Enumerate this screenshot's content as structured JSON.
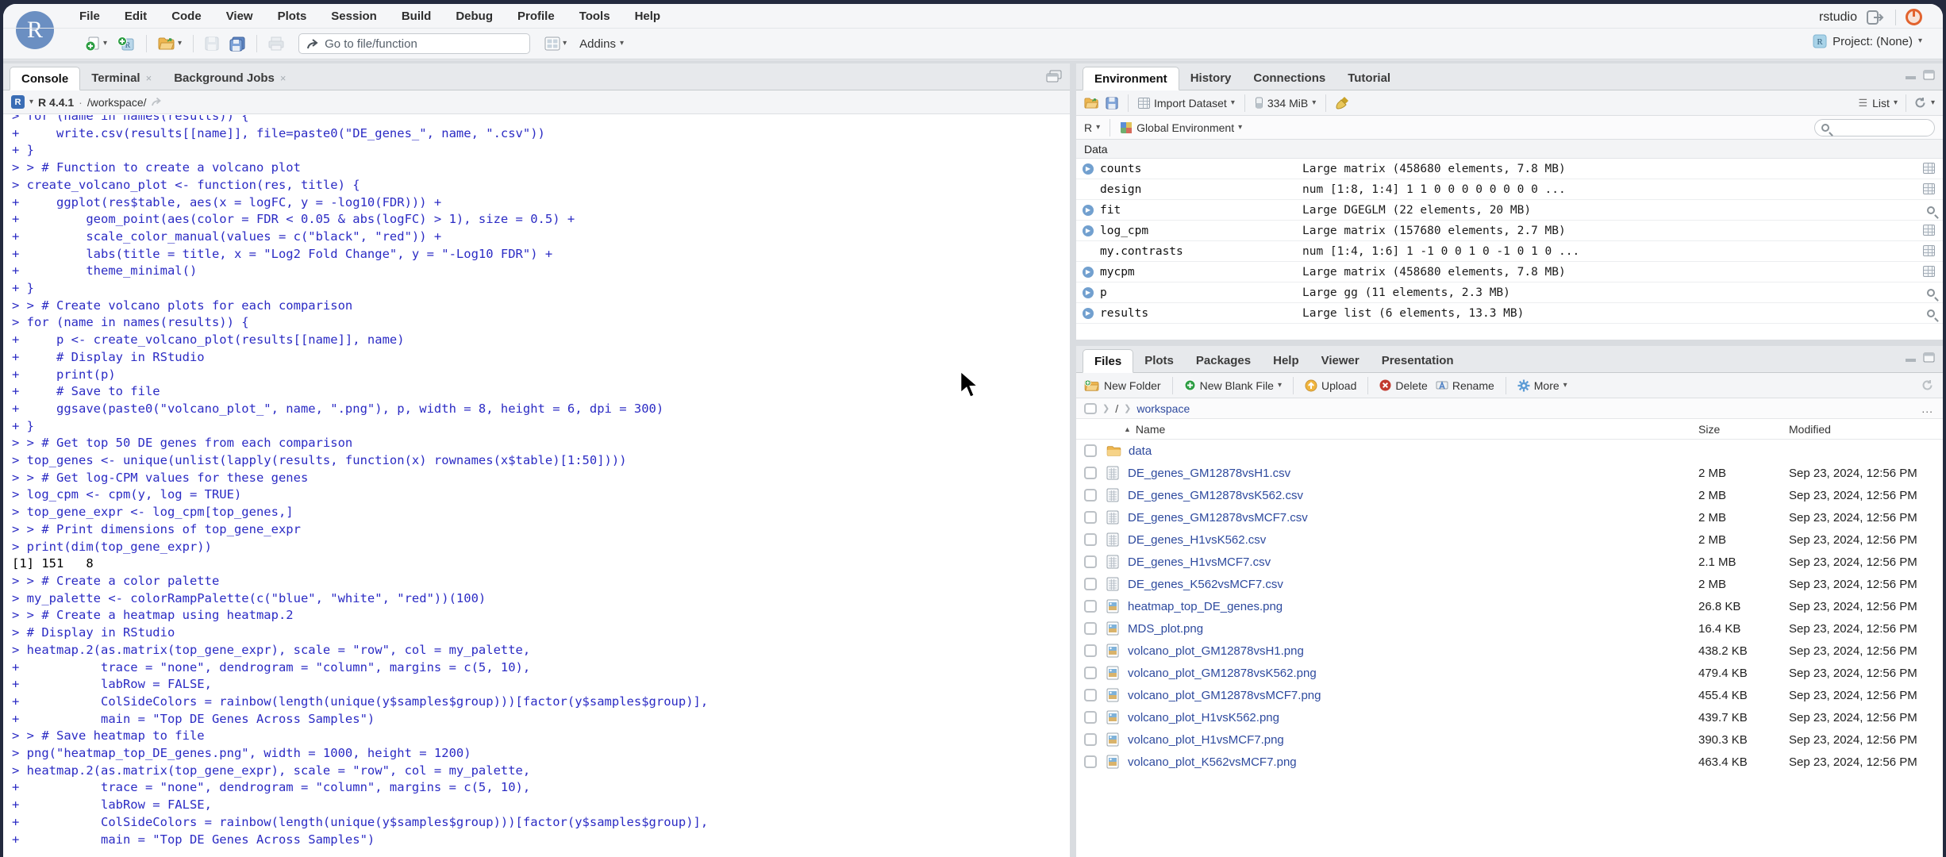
{
  "window": {
    "user_label": "rstudio",
    "project_label": "Project: (None)"
  },
  "menubar": {
    "items": [
      "File",
      "Edit",
      "Code",
      "View",
      "Plots",
      "Session",
      "Build",
      "Debug",
      "Profile",
      "Tools",
      "Help"
    ]
  },
  "toolbar": {
    "goto_placeholder": "Go to file/function",
    "addins_label": "Addins"
  },
  "console": {
    "tabs": [
      {
        "label": "Console",
        "active": true,
        "closable": false
      },
      {
        "label": "Terminal",
        "active": false,
        "closable": true
      },
      {
        "label": "Background Jobs",
        "active": false,
        "closable": true
      }
    ],
    "header": {
      "r_version": "R 4.4.1",
      "separator": "·",
      "path": "/workspace/"
    },
    "lines": [
      {
        "text": "> for (name in names(results)) {",
        "type": "input"
      },
      {
        "text": "+     write.csv(results[[name]], file=paste0(\"DE_genes_\", name, \".csv\"))",
        "type": "input"
      },
      {
        "text": "+ }",
        "type": "input"
      },
      {
        "text": "> > # Function to create a volcano plot",
        "type": "input"
      },
      {
        "text": "> create_volcano_plot <- function(res, title) {",
        "type": "input"
      },
      {
        "text": "+     ggplot(res$table, aes(x = logFC, y = -log10(FDR))) +",
        "type": "input"
      },
      {
        "text": "+         geom_point(aes(color = FDR < 0.05 & abs(logFC) > 1), size = 0.5) +",
        "type": "input"
      },
      {
        "text": "+         scale_color_manual(values = c(\"black\", \"red\")) +",
        "type": "input"
      },
      {
        "text": "+         labs(title = title, x = \"Log2 Fold Change\", y = \"-Log10 FDR\") +",
        "type": "input"
      },
      {
        "text": "+         theme_minimal()",
        "type": "input"
      },
      {
        "text": "+ }",
        "type": "input"
      },
      {
        "text": "> > # Create volcano plots for each comparison",
        "type": "input"
      },
      {
        "text": "> for (name in names(results)) {",
        "type": "input"
      },
      {
        "text": "+     p <- create_volcano_plot(results[[name]], name)",
        "type": "input"
      },
      {
        "text": "+     # Display in RStudio",
        "type": "input"
      },
      {
        "text": "+     print(p)",
        "type": "input"
      },
      {
        "text": "+     # Save to file",
        "type": "input"
      },
      {
        "text": "+     ggsave(paste0(\"volcano_plot_\", name, \".png\"), p, width = 8, height = 6, dpi = 300)",
        "type": "input"
      },
      {
        "text": "+ }",
        "type": "input"
      },
      {
        "text": "> > # Get top 50 DE genes from each comparison",
        "type": "input"
      },
      {
        "text": "> top_genes <- unique(unlist(lapply(results, function(x) rownames(x$table)[1:50])))",
        "type": "input"
      },
      {
        "text": "> > # Get log-CPM values for these genes",
        "type": "input"
      },
      {
        "text": "> log_cpm <- cpm(y, log = TRUE)",
        "type": "input"
      },
      {
        "text": "> top_gene_expr <- log_cpm[top_genes,]",
        "type": "input"
      },
      {
        "text": "> > # Print dimensions of top_gene_expr",
        "type": "input"
      },
      {
        "text": "> print(dim(top_gene_expr))",
        "type": "input"
      },
      {
        "text": "[1] 151   8",
        "type": "output"
      },
      {
        "text": "> > # Create a color palette",
        "type": "input"
      },
      {
        "text": "> my_palette <- colorRampPalette(c(\"blue\", \"white\", \"red\"))(100)",
        "type": "input"
      },
      {
        "text": "> > # Create a heatmap using heatmap.2",
        "type": "input"
      },
      {
        "text": "> # Display in RStudio",
        "type": "input"
      },
      {
        "text": "> heatmap.2(as.matrix(top_gene_expr), scale = \"row\", col = my_palette,",
        "type": "input"
      },
      {
        "text": "+           trace = \"none\", dendrogram = \"column\", margins = c(5, 10),",
        "type": "input"
      },
      {
        "text": "+           labRow = FALSE,",
        "type": "input"
      },
      {
        "text": "+           ColSideColors = rainbow(length(unique(y$samples$group)))[factor(y$samples$group)],",
        "type": "input"
      },
      {
        "text": "+           main = \"Top DE Genes Across Samples\")",
        "type": "input"
      },
      {
        "text": "> > # Save heatmap to file",
        "type": "input"
      },
      {
        "text": "> png(\"heatmap_top_DE_genes.png\", width = 1000, height = 1200)",
        "type": "input"
      },
      {
        "text": "> heatmap.2(as.matrix(top_gene_expr), scale = \"row\", col = my_palette,",
        "type": "input"
      },
      {
        "text": "+           trace = \"none\", dendrogram = \"column\", margins = c(5, 10),",
        "type": "input"
      },
      {
        "text": "+           labRow = FALSE,",
        "type": "input"
      },
      {
        "text": "+           ColSideColors = rainbow(length(unique(y$samples$group)))[factor(y$samples$group)],",
        "type": "input"
      },
      {
        "text": "+           main = \"Top DE Genes Across Samples\")",
        "type": "input"
      }
    ]
  },
  "environment": {
    "tabs": [
      "Environment",
      "History",
      "Connections",
      "Tutorial"
    ],
    "active_tab": "Environment",
    "toolbar": {
      "import_label": "Import Dataset",
      "memory_label": "334 MiB",
      "list_label": "List"
    },
    "scope": {
      "lang_label": "R",
      "env_label": "Global Environment"
    },
    "section_label": "Data",
    "rows": [
      {
        "name": "counts",
        "value": "Large matrix (458680 elements,  7.8 MB)",
        "expandable": true,
        "action": "table"
      },
      {
        "name": "design",
        "value": "num [1:8, 1:4] 1 1 0 0 0 0 0 0 0 0 ...",
        "expandable": false,
        "action": "table"
      },
      {
        "name": "fit",
        "value": "Large DGEGLM (22 elements,  20 MB)",
        "expandable": true,
        "action": "search"
      },
      {
        "name": "log_cpm",
        "value": "Large matrix (157680 elements,  2.7 MB)",
        "expandable": true,
        "action": "table"
      },
      {
        "name": "my.contrasts",
        "value": "num [1:4, 1:6] 1 -1 0 0 1 0 -1 0 1 0 ...",
        "expandable": false,
        "action": "table"
      },
      {
        "name": "mycpm",
        "value": "Large matrix (458680 elements,  7.8 MB)",
        "expandable": true,
        "action": "table"
      },
      {
        "name": "p",
        "value": "Large gg (11 elements,  2.3 MB)",
        "expandable": true,
        "action": "search"
      },
      {
        "name": "results",
        "value": "Large list (6 elements,  13.3 MB)",
        "expandable": true,
        "action": "search"
      }
    ]
  },
  "files": {
    "tabs": [
      "Files",
      "Plots",
      "Packages",
      "Help",
      "Viewer",
      "Presentation"
    ],
    "active_tab": "Files",
    "toolbar": {
      "new_folder": "New Folder",
      "new_blank_file": "New Blank File",
      "upload": "Upload",
      "delete": "Delete",
      "rename": "Rename",
      "more": "More"
    },
    "breadcrumb": {
      "root": "/",
      "folder": "workspace",
      "ellipsis": "..."
    },
    "columns": {
      "name": "Name",
      "size": "Size",
      "modified": "Modified"
    },
    "rows": [
      {
        "name": "data",
        "type": "folder",
        "size": "",
        "modified": ""
      },
      {
        "name": "DE_genes_GM12878vsH1.csv",
        "type": "csv",
        "size": "2 MB",
        "modified": "Sep 23, 2024, 12:56 PM"
      },
      {
        "name": "DE_genes_GM12878vsK562.csv",
        "type": "csv",
        "size": "2 MB",
        "modified": "Sep 23, 2024, 12:56 PM"
      },
      {
        "name": "DE_genes_GM12878vsMCF7.csv",
        "type": "csv",
        "size": "2 MB",
        "modified": "Sep 23, 2024, 12:56 PM"
      },
      {
        "name": "DE_genes_H1vsK562.csv",
        "type": "csv",
        "size": "2 MB",
        "modified": "Sep 23, 2024, 12:56 PM"
      },
      {
        "name": "DE_genes_H1vsMCF7.csv",
        "type": "csv",
        "size": "2.1 MB",
        "modified": "Sep 23, 2024, 12:56 PM"
      },
      {
        "name": "DE_genes_K562vsMCF7.csv",
        "type": "csv",
        "size": "2 MB",
        "modified": "Sep 23, 2024, 12:56 PM"
      },
      {
        "name": "heatmap_top_DE_genes.png",
        "type": "image",
        "size": "26.8 KB",
        "modified": "Sep 23, 2024, 12:56 PM"
      },
      {
        "name": "MDS_plot.png",
        "type": "image",
        "size": "16.4 KB",
        "modified": "Sep 23, 2024, 12:56 PM"
      },
      {
        "name": "volcano_plot_GM12878vsH1.png",
        "type": "image",
        "size": "438.2 KB",
        "modified": "Sep 23, 2024, 12:56 PM"
      },
      {
        "name": "volcano_plot_GM12878vsK562.png",
        "type": "image",
        "size": "479.4 KB",
        "modified": "Sep 23, 2024, 12:56 PM"
      },
      {
        "name": "volcano_plot_GM12878vsMCF7.png",
        "type": "image",
        "size": "455.4 KB",
        "modified": "Sep 23, 2024, 12:56 PM"
      },
      {
        "name": "volcano_plot_H1vsK562.png",
        "type": "image",
        "size": "439.7 KB",
        "modified": "Sep 23, 2024, 12:56 PM"
      },
      {
        "name": "volcano_plot_H1vsMCF7.png",
        "type": "image",
        "size": "390.3 KB",
        "modified": "Sep 23, 2024, 12:56 PM"
      },
      {
        "name": "volcano_plot_K562vsMCF7.png",
        "type": "image",
        "size": "463.4 KB",
        "modified": "Sep 23, 2024, 12:56 PM"
      }
    ]
  }
}
